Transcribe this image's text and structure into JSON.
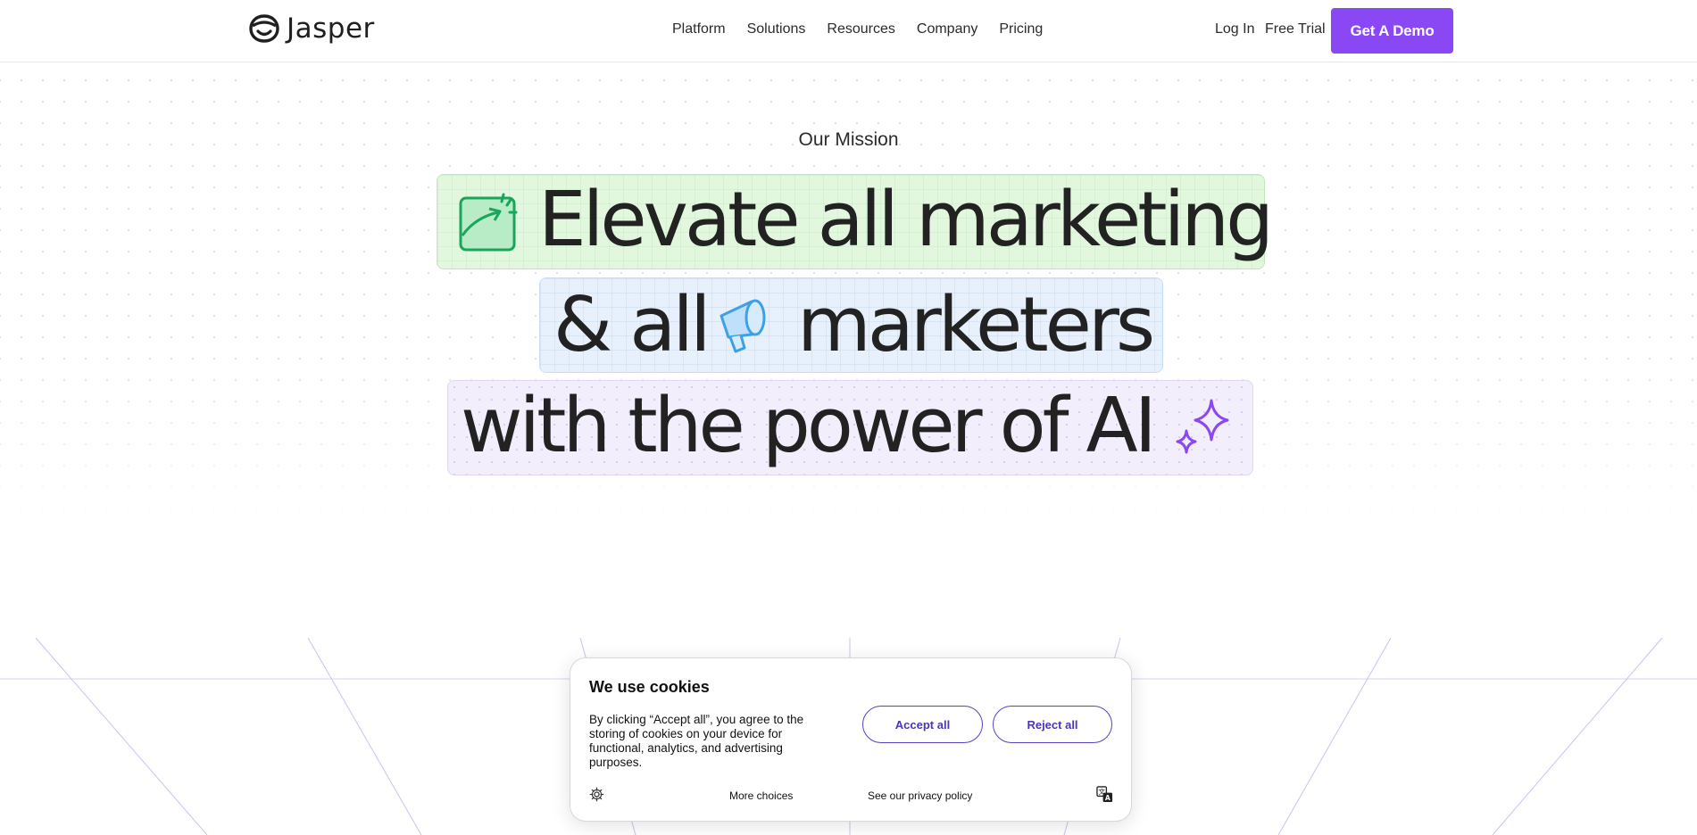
{
  "brand": {
    "name": "Jasper",
    "icon": "jasper-logo-icon",
    "accent": "#8a48f5"
  },
  "nav": {
    "items": [
      {
        "label": "Platform"
      },
      {
        "label": "Solutions"
      },
      {
        "label": "Resources"
      },
      {
        "label": "Company"
      },
      {
        "label": "Pricing"
      }
    ],
    "login_label": "Log In",
    "trial_label": "Free Trial",
    "demo_label": "Get A Demo"
  },
  "hero": {
    "eyebrow": "Our Mission",
    "line1": {
      "text": "Elevate all marketing",
      "icon": "growth-chart-icon",
      "bg": "#e3f7df"
    },
    "line2": {
      "text_before": "& all",
      "text_after": "marketers",
      "icon": "megaphone-icon",
      "bg": "#e8f1fb"
    },
    "line3": {
      "text": "with the power of AI",
      "icon": "sparkle-icon",
      "bg": "#f3eefc"
    }
  },
  "cookie": {
    "title": "We use cookies",
    "body": "By clicking “Accept all”, you agree to the storing of cookies on your device for functional, analytics, and advertising purposes.",
    "accept_label": "Accept all",
    "reject_label": "Reject all",
    "more_label": "More choices",
    "privacy_label": "See our privacy policy",
    "settings_icon": "gear-icon",
    "language_icon": "translate-icon"
  }
}
